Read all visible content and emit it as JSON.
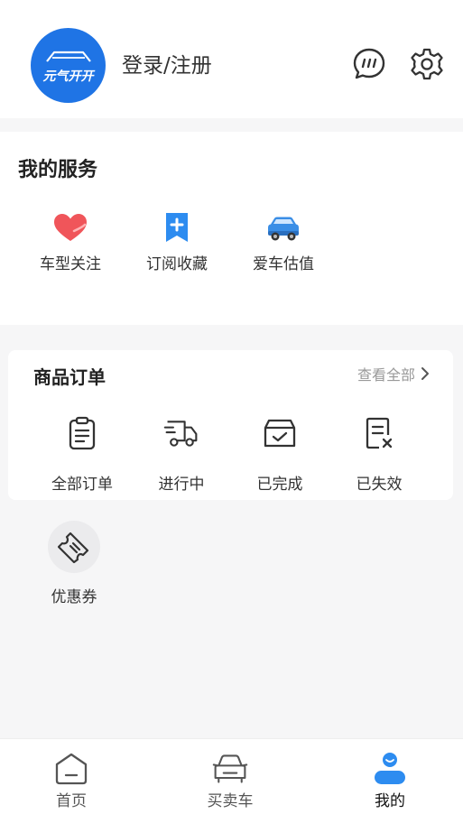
{
  "header": {
    "logo_text": "元气开开",
    "login_label": "登录/注册",
    "icons": [
      "chat-bubble-icon",
      "gear-icon"
    ]
  },
  "services": {
    "title": "我的服务",
    "items": [
      {
        "label": "车型关注",
        "icon": "heart-icon"
      },
      {
        "label": "订阅收藏",
        "icon": "bookmark-plus-icon"
      },
      {
        "label": "爱车估值",
        "icon": "car-icon"
      }
    ]
  },
  "orders": {
    "title": "商品订单",
    "view_all": "查看全部",
    "items": [
      {
        "label": "全部订单",
        "icon": "clipboard-icon"
      },
      {
        "label": "进行中",
        "icon": "truck-icon"
      },
      {
        "label": "已完成",
        "icon": "box-check-icon"
      },
      {
        "label": "已失效",
        "icon": "document-x-icon"
      }
    ]
  },
  "extras": {
    "coupon_label": "优惠券",
    "coupon_icon": "ticket-icon"
  },
  "tabbar": {
    "items": [
      {
        "label": "首页",
        "icon": "home-icon"
      },
      {
        "label": "买卖车",
        "icon": "car-front-icon"
      },
      {
        "label": "我的",
        "icon": "profile-icon"
      }
    ],
    "active": "我的"
  },
  "colors": {
    "brand_blue": "#1f74e5",
    "heart_red": "#f0555a",
    "bookmark_blue": "#2d8cf0",
    "page_bg": "#f6f6f7"
  }
}
